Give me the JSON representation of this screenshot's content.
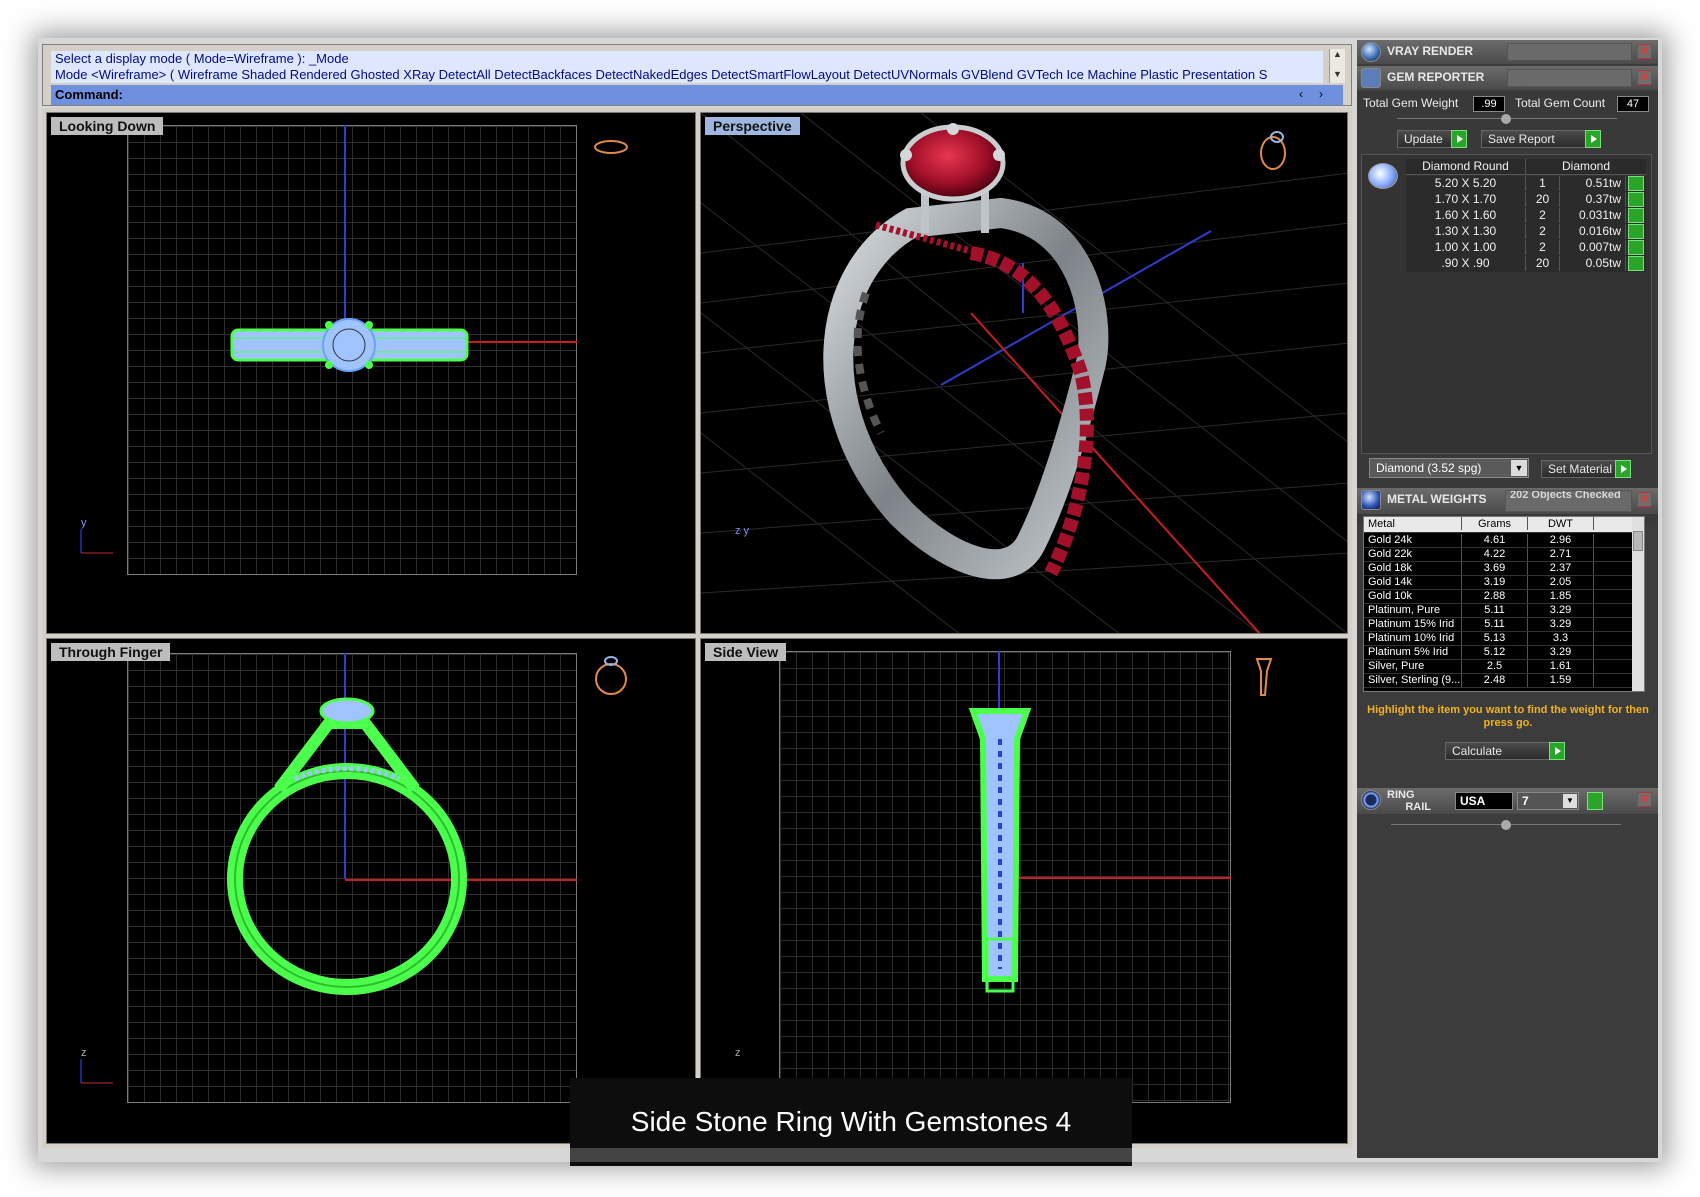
{
  "command": {
    "prompt_line": "Select a display mode ( Mode=Wireframe ): _Mode",
    "options_line": "Mode <Wireframe> ( Wireframe  Shaded  Rendered  Ghosted  XRay  DetectAll  DetectBackfaces  DetectNakedEdges  DetectSmartFlowLayout  DetectUVNormals  GVBlend  GVTech  Ice  Machine  Plastic  Presentation  S",
    "input_label": "Command:"
  },
  "viewports": {
    "top_left": {
      "title": "Looking Down",
      "triad": "y"
    },
    "top_right": {
      "title": "Perspective",
      "triad": "z y"
    },
    "bottom_left": {
      "title": "Through Finger",
      "triad": "z"
    },
    "bottom_right": {
      "title": "Side View",
      "triad": "z"
    }
  },
  "sidebar": {
    "vray": {
      "title": "VRAY RENDER"
    },
    "gem_reporter": {
      "title": "GEM REPORTER",
      "total_weight_label": "Total Gem Weight",
      "total_weight_value": ".99",
      "total_count_label": "Total Gem Count",
      "total_count_value": "47",
      "update_label": "Update",
      "save_report_label": "Save Report",
      "table_header": {
        "shape": "Diamond Round",
        "material": "Diamond"
      },
      "rows": [
        {
          "size": "5.20 X 5.20",
          "count": "1",
          "weight": "0.51tw"
        },
        {
          "size": "1.70 X 1.70",
          "count": "20",
          "weight": "0.37tw"
        },
        {
          "size": "1.60 X 1.60",
          "count": "2",
          "weight": "0.031tw"
        },
        {
          "size": "1.30 X 1.30",
          "count": "2",
          "weight": "0.016tw"
        },
        {
          "size": "1.00 X 1.00",
          "count": "2",
          "weight": "0.007tw"
        },
        {
          "size": ".90 X .90",
          "count": "20",
          "weight": "0.05tw"
        }
      ],
      "material_select": "Diamond    (3.52 spg)",
      "set_material_label": "Set Material"
    },
    "metal_weights": {
      "title": "METAL WEIGHTS",
      "status": "202 Objects Checked",
      "columns": [
        "Metal",
        "Grams",
        "DWT"
      ],
      "rows": [
        {
          "metal": "Gold 24k",
          "grams": "4.61",
          "dwt": "2.96"
        },
        {
          "metal": "Gold 22k",
          "grams": "4.22",
          "dwt": "2.71"
        },
        {
          "metal": "Gold 18k",
          "grams": "3.69",
          "dwt": "2.37"
        },
        {
          "metal": "Gold 14k",
          "grams": "3.19",
          "dwt": "2.05"
        },
        {
          "metal": "Gold 10k",
          "grams": "2.88",
          "dwt": "1.85"
        },
        {
          "metal": "Platinum, Pure",
          "grams": "5.11",
          "dwt": "3.29"
        },
        {
          "metal": "Platinum 15% Irid",
          "grams": "5.11",
          "dwt": "3.29"
        },
        {
          "metal": "Platinum 10% Irid",
          "grams": "5.13",
          "dwt": "3.3"
        },
        {
          "metal": "Platinum 5% Irid",
          "grams": "5.12",
          "dwt": "3.29"
        },
        {
          "metal": "Silver, Pure",
          "grams": "2.5",
          "dwt": "1.61"
        },
        {
          "metal": "Silver, Sterling (9...",
          "grams": "2.48",
          "dwt": "1.59"
        }
      ],
      "hint": "Highlight the item you want to find the weight for then press go.",
      "calculate_label": "Calculate"
    },
    "ring_rail": {
      "title_line1": "RING",
      "title_line2": "RAIL",
      "standard": "USA",
      "size": "7"
    }
  },
  "caption": "Side Stone Ring With Gemstones 4",
  "colors": {
    "wire_green": "#4dff4d",
    "wire_blue": "#9fc4ff",
    "axis_red": "#c81e1e",
    "axis_blue": "#2e3ed0",
    "ruby": "#a3102a",
    "metal": "#9ea3a8"
  }
}
